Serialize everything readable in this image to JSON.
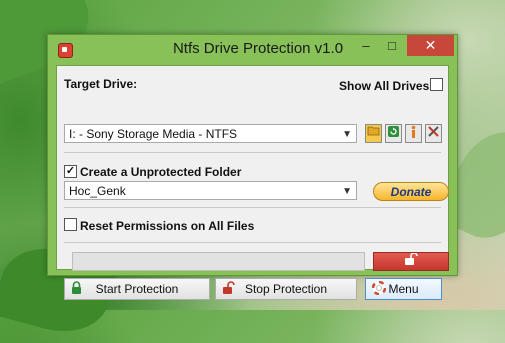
{
  "window": {
    "title": "Ntfs Drive Protection v1.0",
    "minimize_glyph": "–",
    "maximize_glyph": "□",
    "close_glyph": "✕"
  },
  "target": {
    "label": "Target Drive:",
    "show_all_label": "Show All Drives",
    "show_all_checked": false,
    "drive_value": "I:  - Sony Storage Media - NTFS"
  },
  "icons": [
    "folder-icon",
    "refresh-icon",
    "info-icon",
    "tools-icon"
  ],
  "folder": {
    "checkbox_label": "Create a Unprotected Folder",
    "checked": true,
    "name_value": "Hoc_Genk",
    "donate_label": "Donate"
  },
  "reset": {
    "label": "Reset Permissions on All Files",
    "checked": false
  },
  "progress": {
    "value": 0
  },
  "buttons": {
    "start_label": "Start Protection",
    "stop_label": "Stop Protection",
    "menu_label": "Menu"
  },
  "colors": {
    "title_bar": "#87c158",
    "close": "#c7483a",
    "donate": "#f7b52b",
    "unlock_button": "#d4473d"
  }
}
